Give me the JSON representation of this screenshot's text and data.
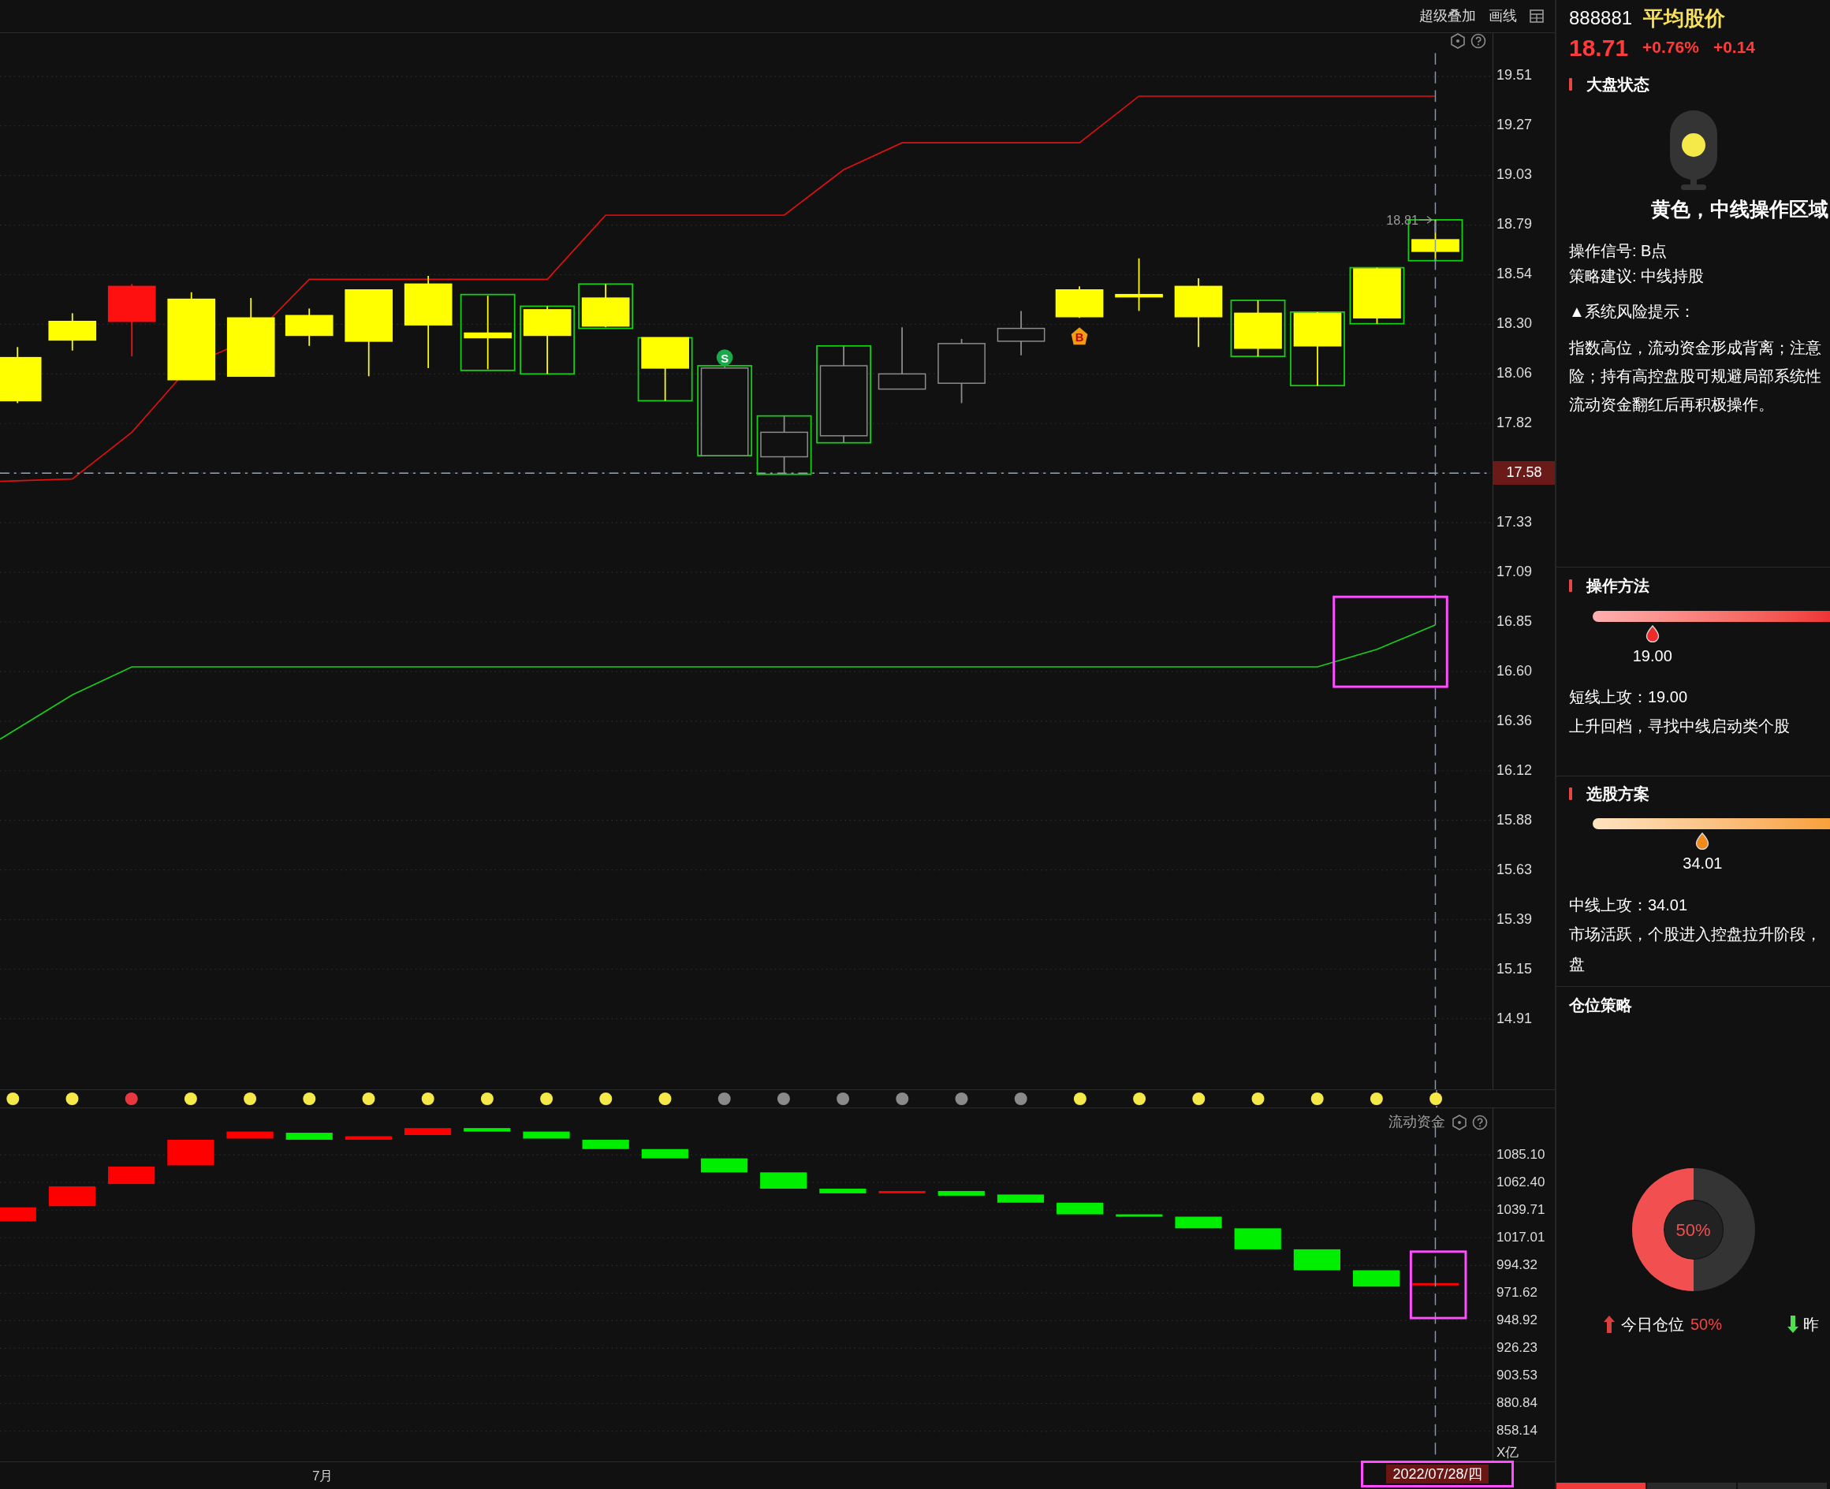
{
  "toolbar": {
    "items": [
      "超级叠加",
      "画线"
    ]
  },
  "main_chart": {
    "axis_ticks": [
      {
        "label": "19.51",
        "highlighted": false
      },
      {
        "label": "19.27",
        "highlighted": false
      },
      {
        "label": "19.03",
        "highlighted": false
      },
      {
        "label": "18.79",
        "highlighted": false
      },
      {
        "label": "18.54",
        "highlighted": false
      },
      {
        "label": "18.30",
        "highlighted": false
      },
      {
        "label": "18.06",
        "highlighted": false
      },
      {
        "label": "17.82",
        "highlighted": false
      },
      {
        "label": "17.58",
        "highlighted": true
      },
      {
        "label": "17.33",
        "highlighted": false
      },
      {
        "label": "17.09",
        "highlighted": false
      },
      {
        "label": "16.85",
        "highlighted": false
      },
      {
        "label": "16.60",
        "highlighted": false
      },
      {
        "label": "16.36",
        "highlighted": false
      },
      {
        "label": "16.12",
        "highlighted": false
      },
      {
        "label": "15.88",
        "highlighted": false
      },
      {
        "label": "15.63",
        "highlighted": false
      },
      {
        "label": "15.39",
        "highlighted": false
      },
      {
        "label": "15.15",
        "highlighted": false
      },
      {
        "label": "14.91",
        "highlighted": false
      }
    ],
    "last_price_label": "18.81",
    "markers": [
      {
        "kind": "sell",
        "label": "S"
      },
      {
        "kind": "buy",
        "label": "B"
      }
    ]
  },
  "signal_dots": [
    {
      "color": "#f5e94a"
    },
    {
      "color": "#f5e94a"
    },
    {
      "color": "#e8383d"
    },
    {
      "color": "#f5e94a"
    },
    {
      "color": "#f5e94a"
    },
    {
      "color": "#f5e94a"
    },
    {
      "color": "#f5e94a"
    },
    {
      "color": "#f5e94a"
    },
    {
      "color": "#f5e94a"
    },
    {
      "color": "#f5e94a"
    },
    {
      "color": "#f5e94a"
    },
    {
      "color": "#f5e94a"
    },
    {
      "color": "#8a8a8a"
    },
    {
      "color": "#8a8a8a"
    },
    {
      "color": "#8a8a8a"
    },
    {
      "color": "#8a8a8a"
    },
    {
      "color": "#8a8a8a"
    },
    {
      "color": "#8a8a8a"
    },
    {
      "color": "#f5e94a"
    },
    {
      "color": "#f5e94a"
    },
    {
      "color": "#f5e94a"
    },
    {
      "color": "#f5e94a"
    },
    {
      "color": "#f5e94a"
    },
    {
      "color": "#f5e94a"
    },
    {
      "color": "#f5e94a"
    }
  ],
  "flow_panel": {
    "title": "流动资金",
    "axis_ticks": [
      "1085.10",
      "1062.40",
      "1039.71",
      "1017.01",
      "994.32",
      "971.62",
      "948.92",
      "926.23",
      "903.53",
      "880.84",
      "858.14"
    ],
    "unit": "X亿"
  },
  "time_axis": {
    "month_label": "7月",
    "cursor_date": "2022/07/28/四"
  },
  "quote": {
    "code": "888881",
    "name": "平均股价",
    "price": "18.71",
    "change_pct": "+0.76%",
    "change": "+0.14"
  },
  "market_state": {
    "title": "大盘状态",
    "status": "黄色，中线操作区域",
    "signal": "操作信号: B点",
    "advice": "策略建议: 中线持股",
    "risk_title": "▲系统风险提示：",
    "risk_lines": [
      "指数高位，流动资金形成背离；注意",
      "险；持有高控盘股可规避局部系统性",
      "流动资金翻红后再积极操作。"
    ]
  },
  "method": {
    "title": "操作方法",
    "level": 0.25,
    "marker_value": "19.00",
    "target": "短线上攻：19.00",
    "note_lines": [
      "上升回档，寻找中线启动类个股"
    ]
  },
  "stock_pick": {
    "title": "选股方案",
    "level": 0.46,
    "marker_value": "34.01",
    "target": "中线上攻：34.01",
    "note_lines": [
      "市场活跃，个股进入控盘拉升阶段，",
      "盘"
    ]
  },
  "position": {
    "title": "仓位策略",
    "level": 0.5,
    "center_label": "50%",
    "today_label": "今日仓位",
    "today_value": "50%",
    "yesterday_label": "昨"
  },
  "bottom_tabs": [
    {
      "selected": true
    },
    {
      "selected": false
    },
    {
      "selected": false
    }
  ]
}
